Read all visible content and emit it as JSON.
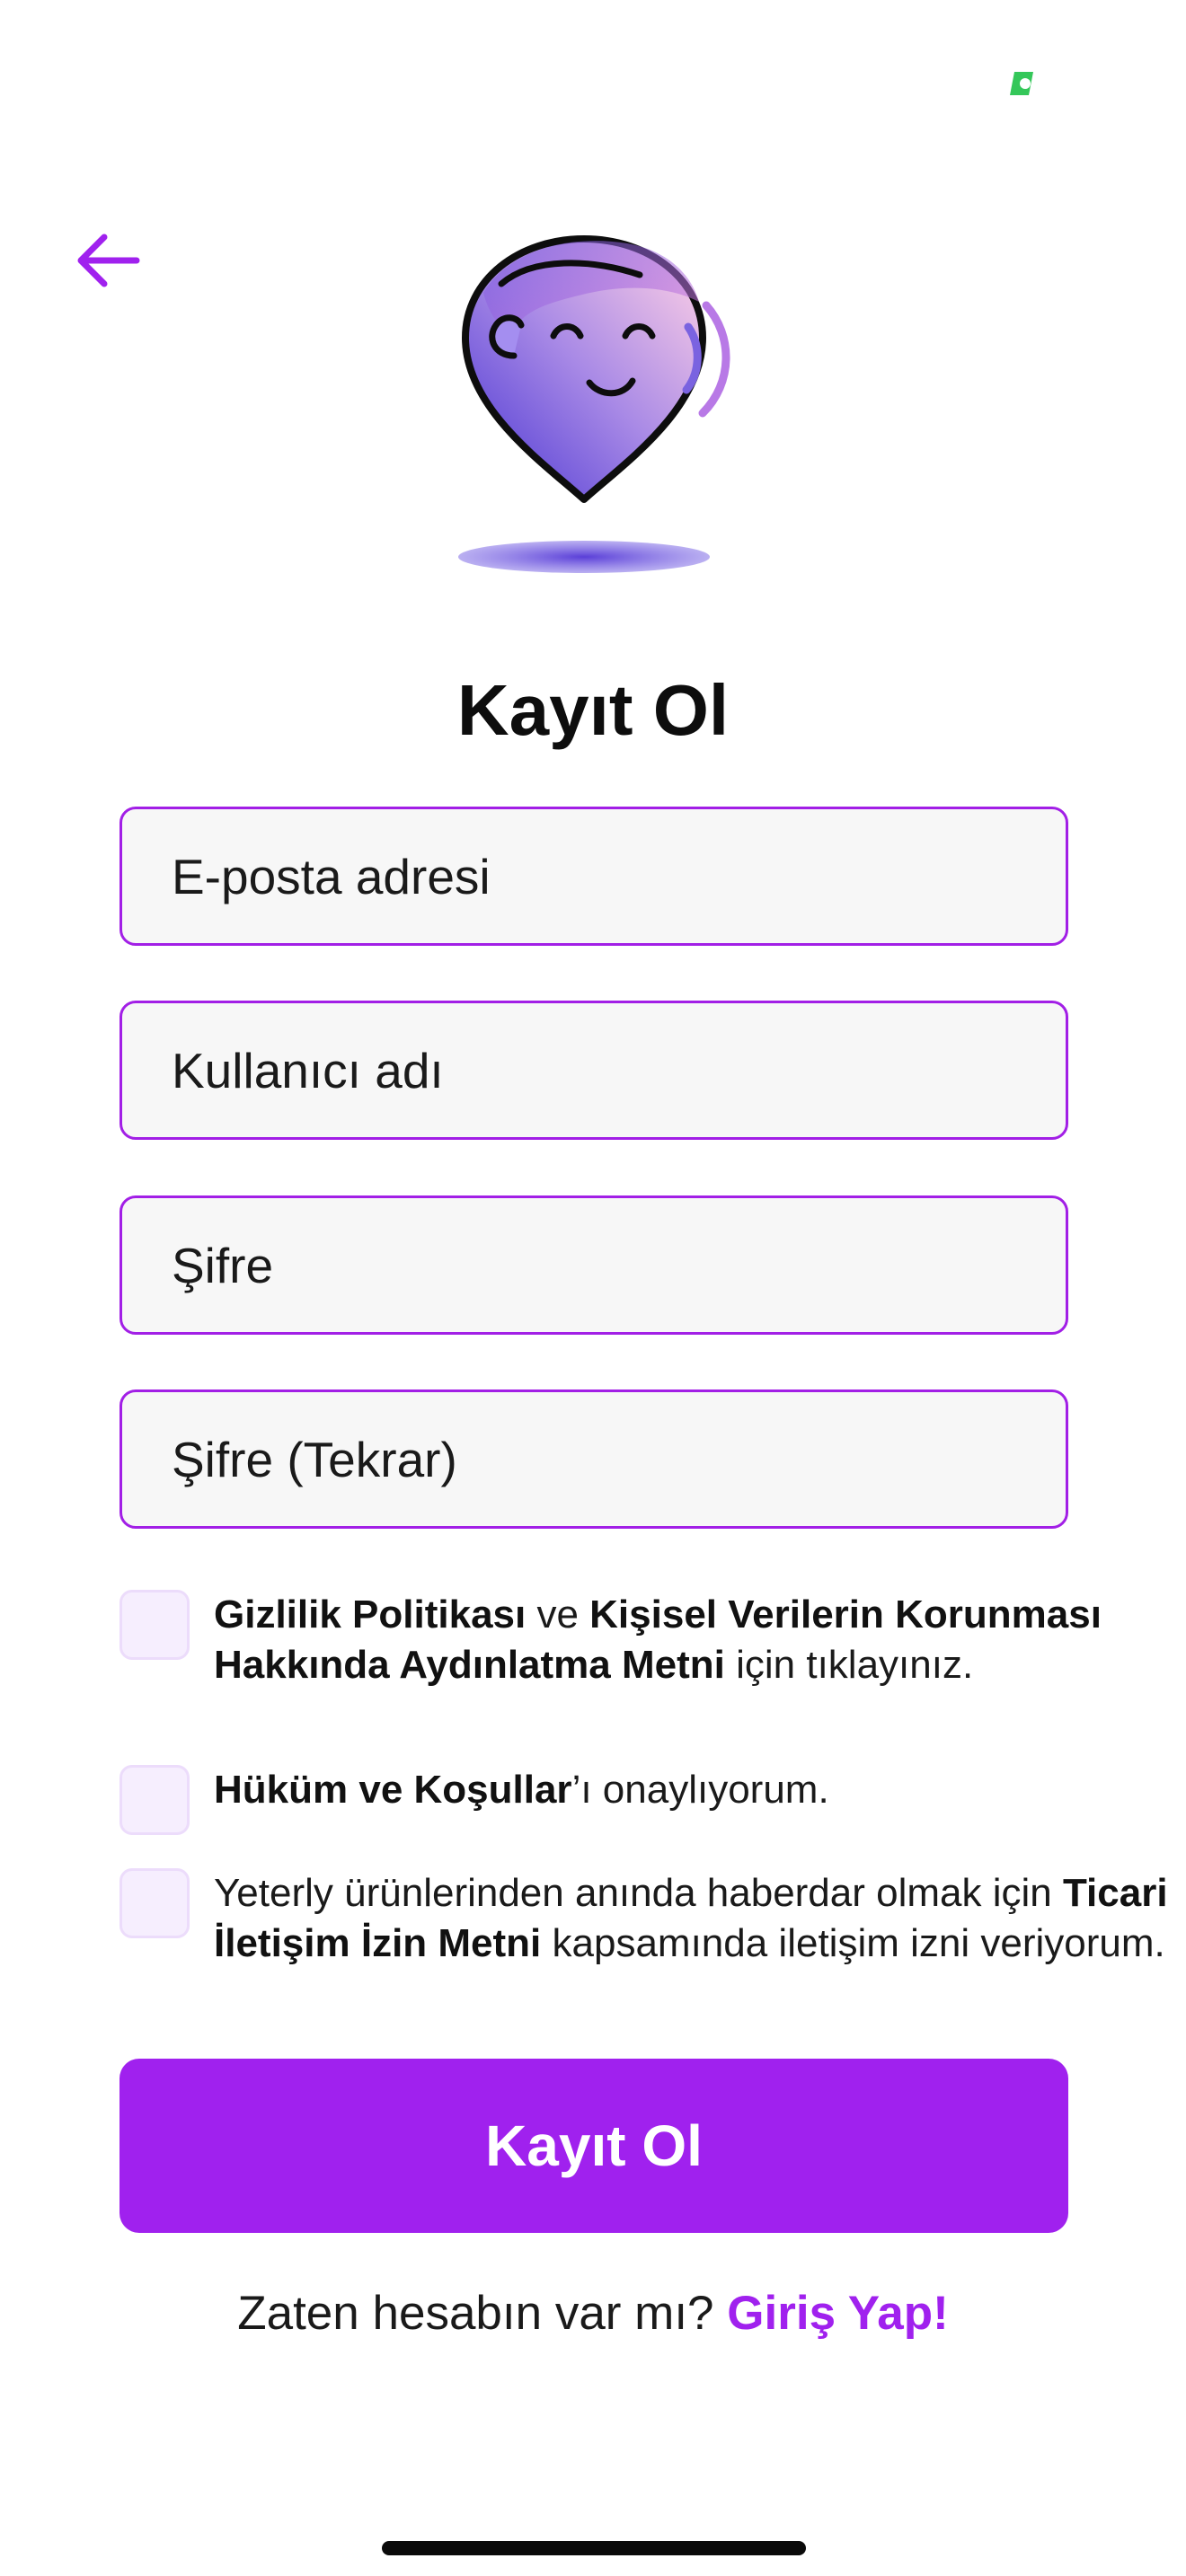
{
  "status_bar": {
    "indicator_color": "#34c759"
  },
  "header": {
    "back_icon": "arrow-left-icon"
  },
  "mascot": {
    "icon": "smiling-face-pin-icon"
  },
  "form": {
    "title": "Kayıt Ol",
    "fields": [
      {
        "placeholder": "E-posta adresi",
        "value": ""
      },
      {
        "placeholder": "Kullanıcı adı",
        "value": ""
      },
      {
        "placeholder": "Şifre",
        "value": ""
      },
      {
        "placeholder": "Şifre (Tekrar)",
        "value": ""
      }
    ],
    "consents": [
      {
        "checked": false,
        "bold_1": "Gizlilik Politikası",
        "text_1": " ve ",
        "bold_2": "Kişisel Verilerin Korunması Hakkında Aydınlatma Metni",
        "text_2": " için tıklayınız."
      },
      {
        "checked": false,
        "bold_1": "Hüküm ve Koşullar",
        "text_1": "’ı onaylıyorum."
      },
      {
        "checked": false,
        "text_1": "Yeterly ürünlerinden anında haberdar olmak için ",
        "bold_1": "Ticari İletişim İzin Metni",
        "text_2": " kapsamında iletişim izni veriyorum."
      }
    ],
    "submit_label": "Kayıt Ol"
  },
  "footer": {
    "prompt": "Zaten hesabın var mı?",
    "login_link": "Giriş Yap!"
  },
  "colors": {
    "accent": "#a021ee",
    "field_border": "#a21fe6",
    "field_bg": "#f7f7f7",
    "checkbox_bg": "#f6eefe"
  }
}
